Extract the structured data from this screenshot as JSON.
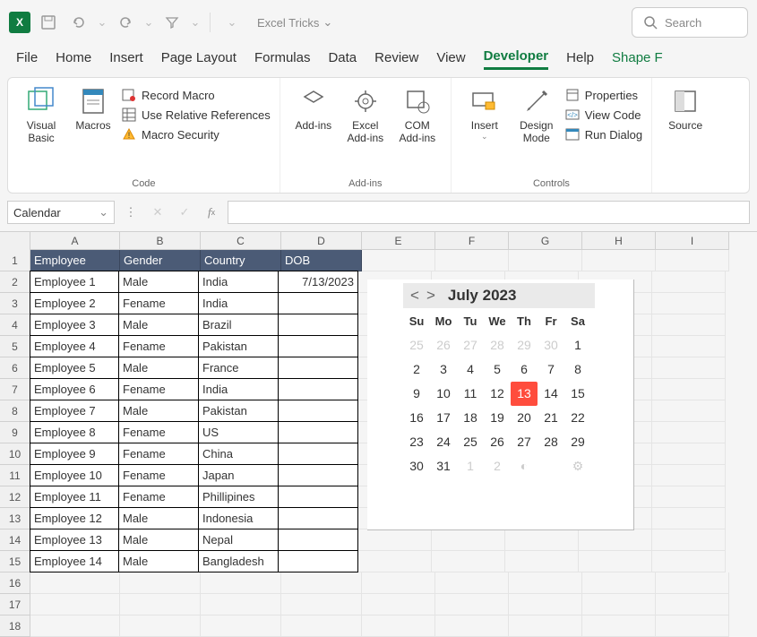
{
  "app": {
    "doc_name": "Excel Tricks",
    "search_placeholder": "Search"
  },
  "tabs": [
    "File",
    "Home",
    "Insert",
    "Page Layout",
    "Formulas",
    "Data",
    "Review",
    "View",
    "Developer",
    "Help",
    "Shape F"
  ],
  "active_tab": "Developer",
  "ribbon": {
    "code": {
      "label": "Code",
      "visual_basic": "Visual Basic",
      "macros": "Macros",
      "record_macro": "Record Macro",
      "use_relative": "Use Relative References",
      "macro_security": "Macro Security"
    },
    "addins": {
      "label": "Add-ins",
      "addins": "Add-ins",
      "excel_addins": "Excel Add-ins",
      "com_addins": "COM Add-ins"
    },
    "controls": {
      "label": "Controls",
      "insert": "Insert",
      "design_mode": "Design Mode",
      "properties": "Properties",
      "view_code": "View Code",
      "run_dialog": "Run Dialog"
    },
    "source": {
      "source": "Source"
    }
  },
  "namebox": "Calendar",
  "columns": [
    "A",
    "B",
    "C",
    "D",
    "E",
    "F",
    "G",
    "H",
    "I"
  ],
  "headers": [
    "Employee",
    "Gender",
    "Country",
    "DOB"
  ],
  "rows": [
    {
      "emp": "Employee 1",
      "gender": "Male",
      "country": "India",
      "dob": "7/13/2023"
    },
    {
      "emp": "Employee 2",
      "gender": "Fename",
      "country": "India",
      "dob": ""
    },
    {
      "emp": "Employee 3",
      "gender": "Male",
      "country": "Brazil",
      "dob": ""
    },
    {
      "emp": "Employee 4",
      "gender": "Fename",
      "country": "Pakistan",
      "dob": ""
    },
    {
      "emp": "Employee 5",
      "gender": "Male",
      "country": "France",
      "dob": ""
    },
    {
      "emp": "Employee 6",
      "gender": "Fename",
      "country": "India",
      "dob": ""
    },
    {
      "emp": "Employee 7",
      "gender": "Male",
      "country": "Pakistan",
      "dob": ""
    },
    {
      "emp": "Employee 8",
      "gender": "Fename",
      "country": "US",
      "dob": ""
    },
    {
      "emp": "Employee 9",
      "gender": "Fename",
      "country": "China",
      "dob": ""
    },
    {
      "emp": "Employee 10",
      "gender": "Fename",
      "country": "Japan",
      "dob": ""
    },
    {
      "emp": "Employee 11",
      "gender": "Fename",
      "country": "Phillipines",
      "dob": ""
    },
    {
      "emp": "Employee 12",
      "gender": "Male",
      "country": "Indonesia",
      "dob": ""
    },
    {
      "emp": "Employee 13",
      "gender": "Male",
      "country": "Nepal",
      "dob": ""
    },
    {
      "emp": "Employee 14",
      "gender": "Male",
      "country": "Bangladesh",
      "dob": ""
    }
  ],
  "calendar": {
    "title": "July 2023",
    "prev": "<",
    "next": ">",
    "days": [
      "Su",
      "Mo",
      "Tu",
      "We",
      "Th",
      "Fr",
      "Sa"
    ],
    "cells": [
      {
        "v": "25",
        "o": true
      },
      {
        "v": "26",
        "o": true
      },
      {
        "v": "27",
        "o": true
      },
      {
        "v": "28",
        "o": true
      },
      {
        "v": "29",
        "o": true
      },
      {
        "v": "30",
        "o": true
      },
      {
        "v": "1"
      },
      {
        "v": "2"
      },
      {
        "v": "3"
      },
      {
        "v": "4"
      },
      {
        "v": "5"
      },
      {
        "v": "6"
      },
      {
        "v": "7"
      },
      {
        "v": "8"
      },
      {
        "v": "9"
      },
      {
        "v": "10"
      },
      {
        "v": "11"
      },
      {
        "v": "12"
      },
      {
        "v": "13",
        "today": true
      },
      {
        "v": "14"
      },
      {
        "v": "15"
      },
      {
        "v": "16"
      },
      {
        "v": "17"
      },
      {
        "v": "18"
      },
      {
        "v": "19"
      },
      {
        "v": "20"
      },
      {
        "v": "21"
      },
      {
        "v": "22"
      },
      {
        "v": "23"
      },
      {
        "v": "24"
      },
      {
        "v": "25"
      },
      {
        "v": "26"
      },
      {
        "v": "27"
      },
      {
        "v": "28"
      },
      {
        "v": "29"
      },
      {
        "v": "30"
      },
      {
        "v": "31"
      },
      {
        "v": "1",
        "o": true
      },
      {
        "v": "2",
        "o": true
      },
      {
        "v": "◐",
        "icon": true
      },
      {
        "v": "",
        "icon": false
      },
      {
        "v": "⚙",
        "icon": true
      }
    ]
  }
}
